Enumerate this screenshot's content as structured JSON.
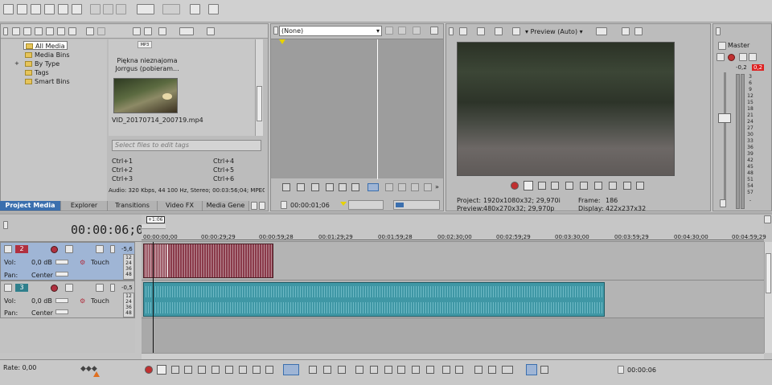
{
  "explorer": {
    "tree": [
      {
        "label": "All Media",
        "selected": true
      },
      {
        "label": "Media Bins"
      },
      {
        "label": "By Type",
        "expand": "+"
      },
      {
        "label": "Tags"
      },
      {
        "label": "Smart Bins"
      }
    ],
    "clip1": {
      "badge": "MP3",
      "title": "Piękna nieznajoma Jorrgus (pobieram..."
    },
    "clip2": {
      "title": "VID_20170714_200719.mp4"
    },
    "tags_placeholder": "Select files to edit tags",
    "shortcuts": [
      "Ctrl+1",
      "Ctrl+4",
      "Ctrl+2",
      "Ctrl+5",
      "Ctrl+3",
      "Ctrl+6"
    ],
    "info": "Audio: 320 Kbps, 44 100 Hz, Stereo; 00:03:56;04; MPEG",
    "tabs": [
      "Project Media",
      "Explorer",
      "Transitions",
      "Video FX",
      "Media Gene"
    ]
  },
  "trimmer": {
    "dropdown": "(None)",
    "timecode": "00:00:01;06"
  },
  "preview": {
    "mode": "Preview (Auto)",
    "project_label": "Project:",
    "project_value": "1920x1080x32; 29,970i",
    "preview_label": "Preview:",
    "preview_value": "480x270x32; 29,970p",
    "frame_label": "Frame:",
    "frame_value": "186",
    "display_label": "Display:",
    "display_value": "422x237x32"
  },
  "master": {
    "title": "Master",
    "peak_l": "-0,2",
    "peak_r": "0,2",
    "scale": [
      "3",
      "6",
      "9",
      "12",
      "15",
      "18",
      "21",
      "24",
      "27",
      "30",
      "33",
      "36",
      "39",
      "42",
      "45",
      "48",
      "51",
      "54",
      "57",
      "-"
    ]
  },
  "timeline": {
    "timecode": "00:00:06;06",
    "marker": "+1:06",
    "ruler": [
      "00:00:00;00",
      "00:00:29;29",
      "00:00:59;28",
      "00:01:29;29",
      "00:01:59;28",
      "00:02:30;00",
      "00:02:59;29",
      "00:03:30;00",
      "00:03:59;29",
      "00:04:30;00",
      "00:04:59;29"
    ],
    "track2": {
      "num": "2",
      "vol_label": "Vol:",
      "vol": "0,0 dB",
      "pan_label": "Pan:",
      "pan": "Center",
      "mode": "Touch",
      "peak": "-5,6",
      "scale": [
        "12",
        "24",
        "36",
        "48"
      ]
    },
    "track3": {
      "num": "3",
      "vol_label": "Vol:",
      "vol": "0,0 dB",
      "pan_label": "Pan:",
      "pan": "Center",
      "mode": "Touch",
      "peak": "-0,5",
      "scale": [
        "12",
        "24",
        "36",
        "48"
      ]
    },
    "rate": "Rate: 0,00",
    "timecode_bottom": "00:00:06"
  },
  "colors": {
    "track_selected": "#9fb5d5",
    "clip_red": "#8a3a4a",
    "clip_teal": "#3f97a5",
    "accent": "#3b6fae"
  }
}
